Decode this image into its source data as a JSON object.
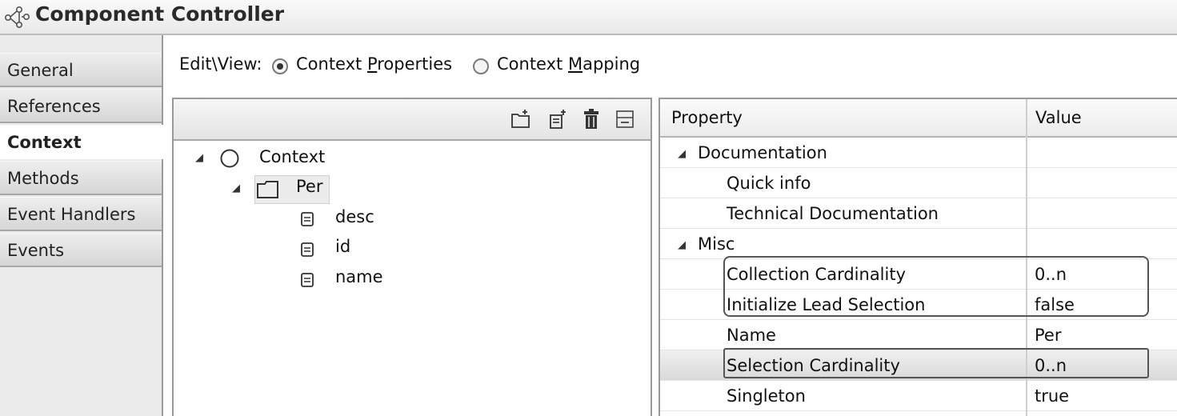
{
  "title": "Component Controller",
  "tabs": [
    "General",
    "References",
    "Context",
    "Methods",
    "Event Handlers",
    "Events"
  ],
  "active_tab": "Context",
  "editview": {
    "label": "Edit\\View:",
    "options": [
      {
        "pre": "Context ",
        "key": "P",
        "post": "roperties",
        "checked": true
      },
      {
        "pre": "Context ",
        "key": "M",
        "post": "apping",
        "checked": false
      }
    ]
  },
  "tree": {
    "root": "Context",
    "node": "Per",
    "attributes": [
      "desc",
      "id",
      "name"
    ]
  },
  "properties": {
    "headers": [
      "Property",
      "Value"
    ],
    "groups": {
      "documentation": "Documentation",
      "misc": "Misc"
    },
    "rows": [
      {
        "name": "Quick info",
        "value": ""
      },
      {
        "name": "Technical Documentation",
        "value": ""
      },
      {
        "name": "Collection Cardinality",
        "value": "0..n"
      },
      {
        "name": "Initialize Lead Selection",
        "value": "false"
      },
      {
        "name": "Name",
        "value": "Per"
      },
      {
        "name": "Selection Cardinality",
        "value": "0..n"
      },
      {
        "name": "Singleton",
        "value": "true"
      }
    ]
  }
}
